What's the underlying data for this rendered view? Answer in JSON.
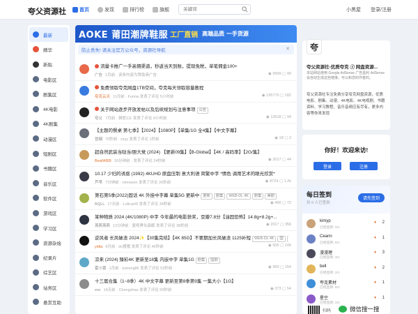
{
  "header": {
    "logo": "夸父资源社",
    "nav": [
      {
        "label": "首页",
        "icon": "home-icon",
        "color": "#2b6de6"
      },
      {
        "label": "发现",
        "icon": "compass-icon",
        "color": "#999999"
      },
      {
        "label": "排行榜",
        "icon": "ranking-icon",
        "color": "#999999"
      },
      {
        "label": "旗舰",
        "icon": "flag-icon",
        "color": "#999999"
      }
    ],
    "search_placeholder": "关键词",
    "right": {
      "user": "小黑屋",
      "login": "登录/注册"
    }
  },
  "sidebar": [
    {
      "label": "最新",
      "color": "#2b6de6"
    },
    {
      "label": "精华",
      "color": "#e5533a"
    },
    {
      "label": "新贴",
      "color": "#333333"
    },
    {
      "label": "电影区",
      "color": "#5b6b83"
    },
    {
      "label": "剧集区",
      "color": "#5b6b83"
    },
    {
      "label": "4K电影",
      "color": "#5b6b83"
    },
    {
      "label": "4K剧集",
      "color": "#5b6b83"
    },
    {
      "label": "动漫区",
      "color": "#5b6b83"
    },
    {
      "label": "短剧区",
      "color": "#5b6b83"
    },
    {
      "label": "书籍区",
      "color": "#5b6b83"
    },
    {
      "label": "音乐区",
      "color": "#5b6b83"
    },
    {
      "label": "软件区",
      "color": "#5b6b83"
    },
    {
      "label": "游戏区",
      "color": "#5b6b83"
    },
    {
      "label": "学习区",
      "color": "#5b6b83"
    },
    {
      "label": "资源杂烩",
      "color": "#5b6b83"
    },
    {
      "label": "纪录片",
      "color": "#5b6b83"
    },
    {
      "label": "综艺区",
      "color": "#5b6b83"
    },
    {
      "label": "站务区",
      "color": "#5b6b83"
    },
    {
      "label": "悬赏互助",
      "color": "#5b6b83"
    }
  ],
  "banner": {
    "part1": "AOKE 莆田潮牌鞋服",
    "part2": "工厂直销",
    "part3": "高端品质 一手货源"
  },
  "notice": "防止丢失! 请关注官方公众号，资源社导航",
  "posts": [
    {
      "title": "流量卡推广一手高佣渠道，秒返当天到账，提现免税，单笔佣金100+",
      "flag": true,
      "tags": [],
      "author": "广告",
      "hot": false,
      "meta": "1月前 · 该条内容为赞助商广告",
      "views": "9999",
      "replies": "99",
      "avatar_color": "#e86a4a"
    },
    {
      "title": "免费领取夸克网盘1TB空间，夸克每天领取容量教程",
      "flag": true,
      "tags": [],
      "author": "夸克云天",
      "hot": true,
      "meta": "11月前 · Furina 发表了评论 5小时前",
      "views": "135775",
      "replies": "182",
      "avatar_color": "#3a7be0"
    },
    {
      "title": "关于网站逐步开放发帖以及后续规划与注意事项",
      "flag": true,
      "tags": [
        "公告"
      ],
      "author": "夸父",
      "hot": false,
      "meta": "7月前 · 狮驼111 发表了评论 9小时前",
      "views": "12618",
      "replies": "94",
      "avatar_color": "#222222"
    },
    {
      "title": "【主题的餐桌 第七季】【2024】【1080P】【单集/1G 全4集】【中文字幕】",
      "flag": false,
      "tags": [],
      "author": "冒烟",
      "hot": false,
      "meta": "70秒前 · zzyy 发表了评论 1秒前",
      "views": "18",
      "replies": "2",
      "avatar_color": "#6b6f7a"
    },
    {
      "title": "超自然武装当哒当/胆大党 (2024) 【更新09集】【B-Global】【4K / 高码率】【2G/集】",
      "flag": false,
      "tags": [],
      "author": "BeatWEB",
      "hot": true,
      "meta": "10分钟前 · 发表了评论 24秒前",
      "views": "3017",
      "replies": "44",
      "avatar_color": "#c89a5a"
    },
    {
      "title": "10.17 少妇的诱惑 (1992) 4KUHD 原盘压制 意大利语 简繁中字 *情色 调用艺术的眼光欣赏*",
      "flag": false,
      "tags": [],
      "author": "芦苇",
      "hot": false,
      "meta": "7分钟前 · nimowen 发表了评论 26秒前",
      "views": "8724",
      "replies": "1.2k",
      "avatar_color": "#3a3a48"
    },
    {
      "title": "第石第5季(2022)固话 4K 外挂中字幕 单集5G 更新中",
      "flag": false,
      "tags": [
        "更新",
        "剧集",
        "WEB-DL 4K",
        "剧集",
        "美剧"
      ],
      "author": "RQLL",
      "hot": false,
      "meta": "17天前 · LuficarW 发表了评论 34秒前",
      "views": "466",
      "replies": "72",
      "avatar_color": "#a3b24a"
    },
    {
      "title": "某种物质 2024 (4K/1080P) 中字 今年最的电影获奖，豆瓣7.8分【油固恐怖】14.8g+8.2g+...",
      "flag": false,
      "tags": [],
      "author": "燕燕燕燕",
      "hot": false,
      "meta": "12分钟前 · 夏呢黑化森眠 发表了评论 38秒前",
      "views": "2017",
      "replies": "356",
      "avatar_color": "#2f3442"
    },
    {
      "title": "逆风者 长风破浪 2024✨【30集完结】【4K 85G】不要期加长风破浪 1125补短",
      "flag": false,
      "tags": [
        "WEB-DL 4K",
        "国",
        "剧集"
      ],
      "author": "yidia",
      "hot": true,
      "meta": "6月前 · dc猪猪 发表了评论 46秒前",
      "views": "505",
      "replies": "106",
      "avatar_color": "#111111"
    },
    {
      "title": "凉来 (2024) 臻彩4K 更新至18集 内嵌中字 单集1G",
      "flag": false,
      "tags": [
        "剧集",
        "国剧"
      ],
      "author": "霍小黄",
      "hot": false,
      "meta": "1月前 · lumeng86 发表了评论 53秒前",
      "views": "960",
      "replies": "154",
      "avatar_color": "#5ea8c8"
    },
    {
      "title": "十三届合集（1~8季）4K 中文字幕 更新至第8季第9集 一集大小【1G】",
      "flag": false,
      "tags": [],
      "author": "xnc",
      "hot": false,
      "meta": "14天前 · Chengshao 发表了评论 59秒前",
      "views": "373",
      "replies": "54",
      "avatar_color": "#8c8c8c"
    }
  ],
  "site": {
    "logo_char": "夸",
    "name": "夸父资源社-优质夸克 ⓢ 网盘资源...",
    "tip": "本站网站使用 Google AdSense 广告盈利 AdSense 会自动生成这些链接，可以和您的作者的。",
    "desc": "夸父资源社专注免费分享夸克网盘资源，优质电影、剧集、动漫、4K电影、4K电视剧、书籍资料、学习教程、音乐音频应有尽有，更多内容等你来发现"
  },
  "welcome": {
    "title": "你好！欢迎来访!",
    "login": "登录",
    "register": "注册"
  },
  "signin": {
    "title": "每日签到",
    "subtitle": "共 0 人已签到",
    "button": "请先签到",
    "users": [
      {
        "name": "kimyp",
        "status": "已经签到: 0/1",
        "rank": "2",
        "color": "#c9a27a"
      },
      {
        "name": "Ceann",
        "status": "已经签到: 5/1",
        "rank": "1",
        "color": "#6a82c4"
      },
      {
        "name": "漫漫理",
        "status": "已经签到: 3/1",
        "rank": "3",
        "color": "#4a4a5a"
      },
      {
        "name": "bell",
        "status": "已经签到: 2/1",
        "rank": "2",
        "color": "#e2b55a"
      },
      {
        "name": "夸克素材",
        "status": "已经签到: 0/1",
        "rank": "1",
        "color": "#3f8fd8"
      },
      {
        "name": "星空",
        "status": "已经签到: 2/2",
        "rank": "1",
        "color": "#8a5ac8"
      }
    ]
  },
  "footer": {
    "qr_label": "扫码",
    "wx_label": "微信搜一搜"
  }
}
